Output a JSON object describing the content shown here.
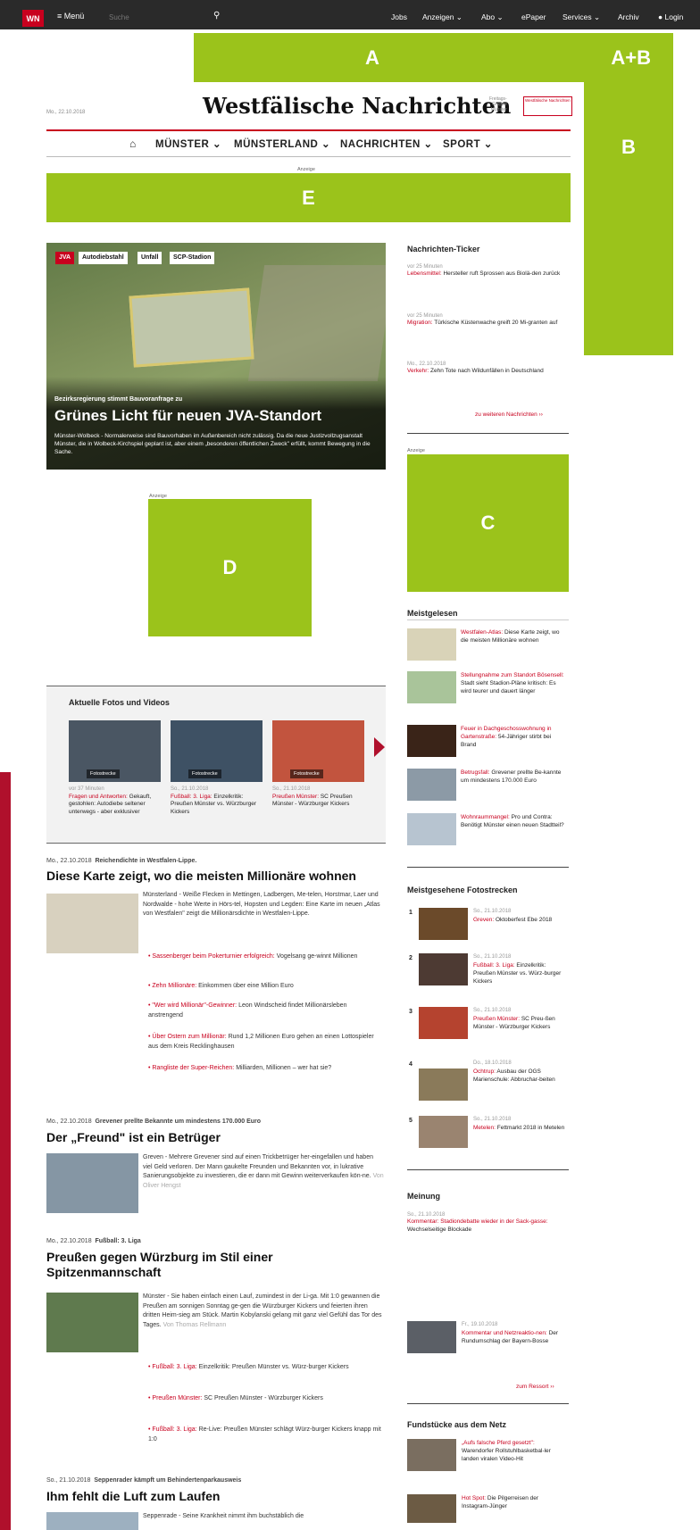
{
  "topbar": {
    "logo": "WN",
    "menu": "≡ Menü",
    "search_placeholder": "Suche",
    "links": [
      "Jobs",
      "Anzeigen ⌄",
      "Abo ⌄",
      "ePaper",
      "Services ⌄",
      "Archiv",
      "Login"
    ]
  },
  "ads": {
    "A": "A",
    "AB": "A+B",
    "B": "B",
    "C": "C",
    "D": "D",
    "E": "E",
    "anzeige": "Anzeige"
  },
  "masthead": {
    "date": "Mo., 22.10.2018",
    "title": "Westfälische Nachrichten",
    "partner_text": "Freitags-\nGruppe\nMünster",
    "partner_logo": "Westfälische Nachrichten"
  },
  "nav": {
    "items": [
      "MÜNSTER ⌄",
      "MÜNSTERLAND ⌄",
      "NACHRICHTEN ⌄",
      "SPORT ⌄"
    ]
  },
  "hero": {
    "tags": [
      "JVA",
      "Autodiebstahl",
      "Unfall",
      "SCP-Stadion"
    ],
    "kicker": "Bezirksregierung stimmt Bauvoranfrage zu",
    "headline": "Grünes Licht für neuen JVA-Standort",
    "teaser": "Münster-Wolbeck - Normalerweise sind Bauvorhaben im Außenbereich nicht zulässig. Da die neue Justizvollzugsanstalt Münster, die in Wolbeck-Kirchspiel geplant ist, aber einem „besonderen öffentlichen Zweck\" erfüllt, kommt Bewegung in die Sache."
  },
  "ticker": {
    "title": "Nachrichten-Ticker",
    "items": [
      {
        "time": "vor 25 Minuten",
        "topic": "Lebensmittel:",
        "text": "Hersteller ruft Sprossen aus Biolä-den zurück"
      },
      {
        "time": "vor 25 Minuten",
        "topic": "Migration:",
        "text": "Türkische Küstenwache greift 20 Mi-granten auf"
      },
      {
        "time": "Mo., 22.10.2018",
        "topic": "Verkehr:",
        "text": "Zehn Tote nach Wildunfällen in Deutschland"
      }
    ],
    "more": "zu weiteren Nachrichten ››"
  },
  "meistgelesen": {
    "title": "Meistgelesen",
    "items": [
      {
        "topic": "Westfalen-Atlas:",
        "text": "Diese Karte zeigt, wo die meisten Millionäre wohnen"
      },
      {
        "topic": "Stellungnahme zum Standort Bösensell:",
        "text": "Stadt sieht Stadion-Pläne kritisch: Es wird teurer und dauert länger"
      },
      {
        "topic": "Feuer in Dachgeschosswohnung in Gartenstraße:",
        "text": "54-Jähriger stirbt bei Brand"
      },
      {
        "topic": "Betrugsfall:",
        "text": "Grevener prellte Be-kannte um mindestens 170.000 Euro"
      },
      {
        "topic": "Wohnraummangel:",
        "text": "Pro und Contra: Benötigt Münster einen neuen Stadtteil?"
      }
    ]
  },
  "fotostrecken": {
    "title": "Meistgesehene Fotostrecken",
    "items": [
      {
        "rank": "1",
        "date": "So., 21.10.2018",
        "topic": "Greven:",
        "text": "Oktoberfest Ebe 2018"
      },
      {
        "rank": "2",
        "date": "So., 21.10.2018",
        "topic": "Fußball: 3. Liga:",
        "text": "Einzelkritik: Preußen Münster vs. Würz-burger Kickers"
      },
      {
        "rank": "3",
        "date": "So., 21.10.2018",
        "topic": "Preußen Münster:",
        "text": "SC Preu-ßen Münster - Würzburger Kickers"
      },
      {
        "rank": "4",
        "date": "Do., 18.10.2018",
        "topic": "Ochtrup:",
        "text": "Ausbau der OGS Marienschule: Abbruchar-beiten"
      },
      {
        "rank": "5",
        "date": "So., 21.10.2018",
        "topic": "Metelen:",
        "text": "Fettmarkt 2018 in Metelen"
      }
    ]
  },
  "meinung": {
    "title": "Meinung",
    "date": "So., 21.10.2018",
    "topic": "Kommentar: Stadiondebatte wieder in der Sack-gasse:",
    "text": "Wechselseitige Blockade",
    "item2_date": "Fr., 19.10.2018",
    "item2_topic": "Kommentar und Netzreaktio-nen:",
    "item2_text": "Der Rundumschlag der Bayern-Bosse",
    "more": "zum Ressort ››"
  },
  "fundstuecke": {
    "title": "Fundstücke aus dem Netz",
    "items": [
      {
        "topic": "„Aufs falsche Pferd gesetzt\":",
        "text": "Warendorfer Rollstuhlbasketbal-ler landen viralen Video-Hit"
      },
      {
        "topic": "Hot Spot:",
        "text": "Die Pilgerreisen der Instagram-Jünger"
      }
    ]
  },
  "media": {
    "title": "Aktuelle Fotos und Videos",
    "label": "Fotostrecke",
    "items": [
      {
        "date": "vor 37 Minuten",
        "topic": "Fragen und Antworten:",
        "text": "Gekauft, gestohlen: Autodiebe seltener unterwegs - aber exklusiver"
      },
      {
        "date": "So., 21.10.2018",
        "topic": "Fußball: 3. Liga:",
        "text": "Einzelkritik: Preußen Münster vs. Würzburger Kickers"
      },
      {
        "date": "So., 21.10.2018",
        "topic": "Preußen Münster:",
        "text": "SC Preußen Münster - Würzburger Kickers"
      }
    ]
  },
  "articles": [
    {
      "date": "Mo., 22.10.2018",
      "kicker": "Reichendichte in Westfalen-Lippe.",
      "title": "Diese Karte zeigt, wo die meisten Millionäre wohnen",
      "text": "Münsterland - Weiße Flecken in Mettingen, Ladbergen, Me-telen, Horstmar, Laer und Nordwalde - hohe Werte in Hörs-tel, Hopsten und Legden: Eine Karte im neuen „Atlas von Westfalen\" zeigt die Millionärsdichte in Westfalen-Lippe.",
      "bullets": [
        {
          "topic": "Sassenberger beim Pokerturnier erfolgreich:",
          "text": "Vogelsang ge-winnt Millionen"
        },
        {
          "topic": "Zehn Millionäre:",
          "text": "Einkommen über eine Million Euro"
        },
        {
          "topic": "\"Wer wird Millionär\"-Gewinner:",
          "text": "Leon Windscheid findet Millionärsleben anstrengend"
        },
        {
          "topic": "Über Ostern zum Millionär:",
          "text": "Rund 1,2 Millionen Euro gehen an einen Lottospieler aus dem Kreis Recklinghausen"
        },
        {
          "topic": "Rangliste der Super-Reichen:",
          "text": "Milliarden, Millionen – wer hat sie?"
        }
      ]
    },
    {
      "date": "Mo., 22.10.2018",
      "kicker": "Grevener prellte Bekannte um mindestens 170.000 Euro",
      "title": "Der „Freund\" ist ein Betrüger",
      "text": "Greven - Mehrere Grevener sind auf einen Trickbetrüger her-eingefallen und haben viel Geld verloren. Der Mann gaukelte Freunden und Bekannten vor, in lukrative Sanierungsobjekte zu investieren, die er dann mit Gewinn weiterverkaufen kön-ne.",
      "author": "Von Oliver Hengst"
    },
    {
      "date": "Mo., 22.10.2018",
      "kicker": "Fußball: 3. Liga",
      "title": "Preußen gegen Würzburg im Stil einer Spitzenmannschaft",
      "text": "Münster - Sie haben einfach einen Lauf, zumindest in der Li-ga. Mit 1:0 gewannen die Preußen am sonnigen Sonntag ge-gen die Würzburger Kickers und feierten ihren dritten Heim-sieg am Stück. Martin Kobylanski gelang mit ganz viel Gefühl das Tor des Tages.",
      "author": "Von Thomas Rellmann",
      "bullets": [
        {
          "topic": "Fußball: 3. Liga:",
          "text": "Einzelkritik: Preußen Münster vs. Würz-burger Kickers"
        },
        {
          "topic": "Preußen Münster:",
          "text": "SC Preußen Münster - Würzburger Kickers"
        },
        {
          "topic": "Fußball: 3. Liga:",
          "text": "Re-Live: Preußen Münster schlägt Würz-burger Kickers knapp mit 1:0"
        }
      ]
    },
    {
      "date": "So., 21.10.2018",
      "kicker": "Seppenrader kämpft um Behindertenparkausweis",
      "title": "Ihm fehlt die Luft zum Laufen",
      "text": "Seppenrade - Seine Krankheit nimmt ihm buchstäblich die"
    }
  ],
  "colors": {
    "brand_red": "#c8001e",
    "ad_green": "#9bc31b",
    "topbar": "#2a2a2a"
  }
}
